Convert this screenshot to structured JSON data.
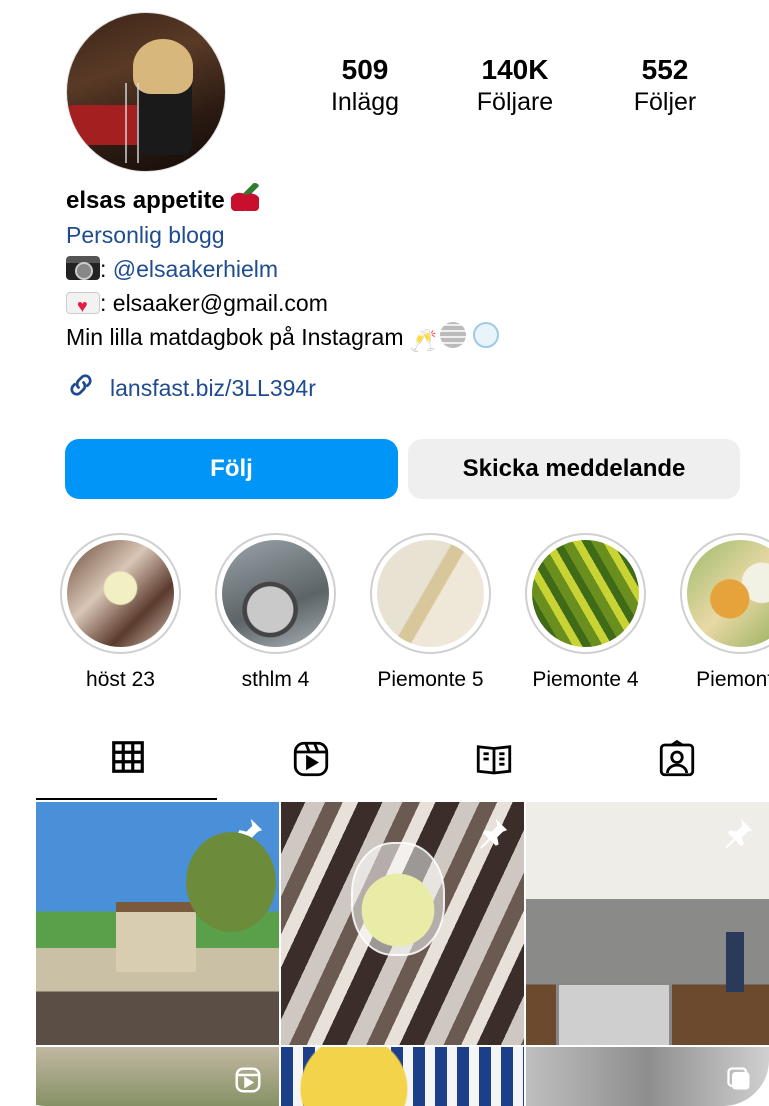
{
  "profile": {
    "stats": [
      {
        "value": "509",
        "label": "Inlägg"
      },
      {
        "value": "140K",
        "label": "Följare"
      },
      {
        "value": "552",
        "label": "Följer"
      }
    ],
    "name": "elsas appetite",
    "category": "Personlig blogg",
    "bio_line1_prefix": ": ",
    "bio_line1_handle": "@elsaakerhielm",
    "bio_line2_prefix": ": elsaaker@gmail.com",
    "bio_line3": "Min lilla matdagbok på Instagram",
    "link": "lansfast.biz/3LL394r"
  },
  "actions": {
    "follow_label": "Följ",
    "message_label": "Skicka meddelande"
  },
  "highlights": [
    {
      "label": "höst 23"
    },
    {
      "label": "sthlm 4"
    },
    {
      "label": "Piemonte 5"
    },
    {
      "label": "Piemonte 4"
    },
    {
      "label": "Piemonte"
    }
  ],
  "tabs": [
    {
      "icon": "grid-icon",
      "active": true
    },
    {
      "icon": "reels-icon",
      "active": false
    },
    {
      "icon": "guides-icon",
      "active": false
    },
    {
      "icon": "tagged-icon",
      "active": false
    }
  ],
  "colors": {
    "accent": "#0095f6",
    "link": "#1e4c8f",
    "secondary_button": "#efefef"
  }
}
